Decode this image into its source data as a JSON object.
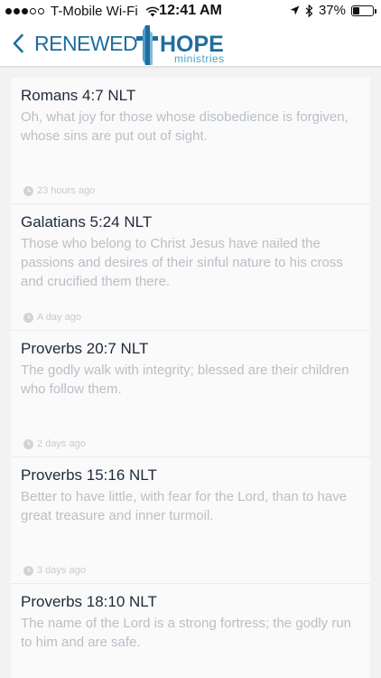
{
  "status_bar": {
    "carrier": "T-Mobile Wi-Fi",
    "time": "12:41 AM",
    "battery": "37%",
    "battery_level": 0.37,
    "signal_bars_filled": 3,
    "signal_bars_total": 5
  },
  "header": {
    "back_icon": "chevron-left-icon",
    "logo_left": "RENEWED",
    "logo_right": "HOPE",
    "logo_sub": "ministries",
    "colors": {
      "brand": "#1f6d9e",
      "brand_light": "#4aa0c9"
    }
  },
  "verses": [
    {
      "reference": "Romans 4:7 NLT",
      "text": "Oh, what joy for those whose disobedience is forgiven, whose sins are put out of sight.",
      "time": "23 hours ago"
    },
    {
      "reference": "Galatians 5:24 NLT",
      "text": "Those who belong to Christ Jesus have nailed the passions and desires of their sinful nature to his cross and crucified them there.",
      "time": "A day ago"
    },
    {
      "reference": "Proverbs 20:7 NLT",
      "text": "The godly walk with integrity; blessed are their children who follow them.",
      "time": "2 days ago"
    },
    {
      "reference": "Proverbs 15:16 NLT",
      "text": "Better to have little, with fear for the Lord, than to have great treasure and inner turmoil.",
      "time": "3 days ago"
    },
    {
      "reference": "Proverbs 18:10 NLT",
      "text": "The name of the Lord is a strong fortress; the godly run to him and are safe.",
      "time": ""
    }
  ]
}
